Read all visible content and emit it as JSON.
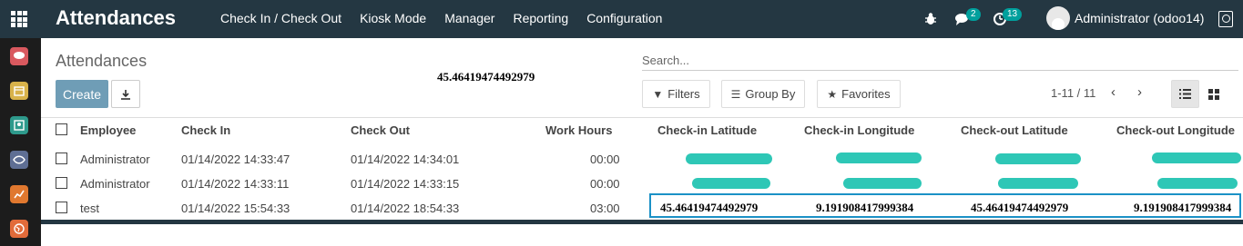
{
  "navbar": {
    "app_title": "Attendances",
    "menu": [
      {
        "label": "Check In / Check Out"
      },
      {
        "label": "Kiosk Mode"
      },
      {
        "label": "Manager"
      },
      {
        "label": "Reporting"
      },
      {
        "label": "Configuration"
      }
    ],
    "messages_badge": "2",
    "activities_badge": "13",
    "user_name": "Administrator (odoo14)"
  },
  "control_panel": {
    "breadcrumb": "Attendances",
    "floating_value": "45.46419474492979",
    "search_placeholder": "Search...",
    "create_label": "Create",
    "filters_label": "Filters",
    "group_by_label": "Group By",
    "favorites_label": "Favorites",
    "pager": "1-11 / 11"
  },
  "table": {
    "columns": [
      "Employee",
      "Check In",
      "Check Out",
      "Work Hours",
      "Check-in Latitude",
      "Check-in Longitude",
      "Check-out Latitude",
      "Check-out Longitude"
    ],
    "rows": [
      {
        "employee": "Administrator",
        "check_in": "01/14/2022 14:33:47",
        "check_out": "01/14/2022 14:34:01",
        "work_hours": "00:00"
      },
      {
        "employee": "Administrator",
        "check_in": "01/14/2022 14:33:11",
        "check_out": "01/14/2022 14:33:15",
        "work_hours": "00:00"
      },
      {
        "employee": "test",
        "check_in": "01/14/2022 15:54:33",
        "check_out": "01/14/2022 18:54:33",
        "work_hours": "03:00",
        "checkin_latitude": "45.46419474492979",
        "checkin_longitude": "9.191908417999384",
        "checkout_latitude": "45.46419474492979",
        "checkout_longitude": "9.191908417999384"
      }
    ]
  },
  "colors": {
    "navbar": "#243742",
    "primary": "#6f9db6",
    "highlight": "#1b91c6",
    "redacted": "#2ec7b6"
  }
}
